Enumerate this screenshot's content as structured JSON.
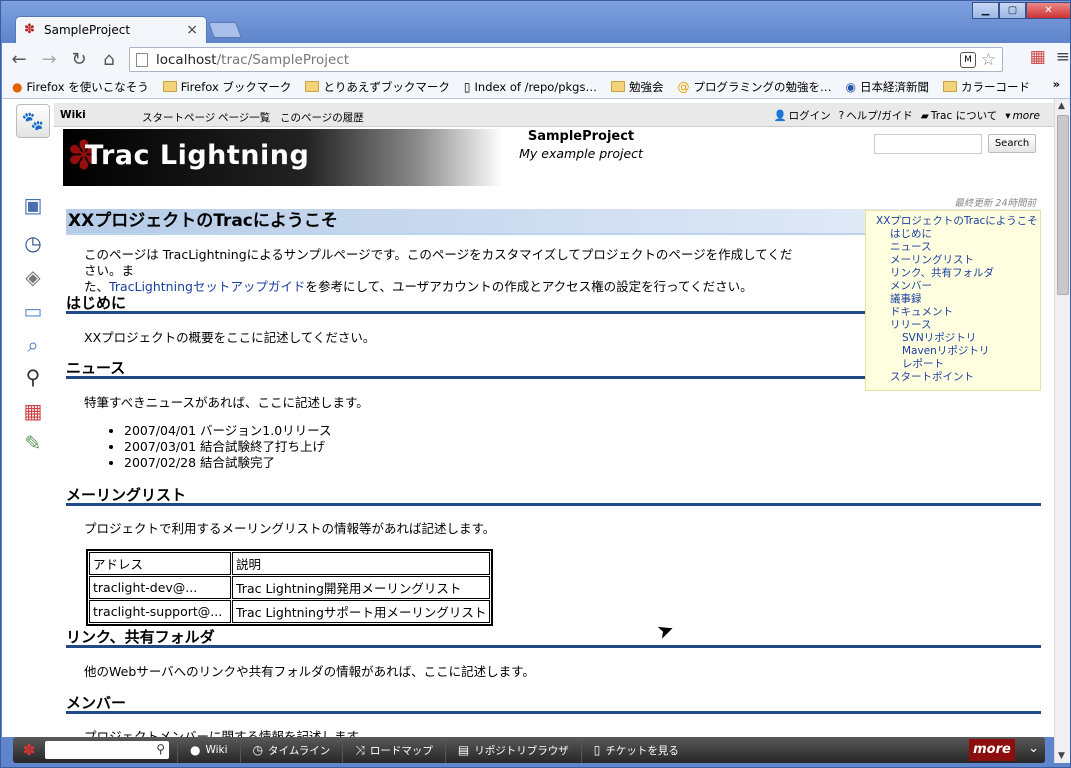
{
  "browser": {
    "tab_title": "SampleProject",
    "tab_close": "×",
    "url_host": "localhost",
    "url_path": "/trac/SampleProject"
  },
  "bookmarks": [
    {
      "label": "Firefox を使いこなそう",
      "icon": "firefox-icon"
    },
    {
      "label": "Firefox ブックマーク",
      "icon": "folder-icon"
    },
    {
      "label": "とりあえずブックマーク",
      "icon": "folder-icon"
    },
    {
      "label": "Index of /repo/pkgs…",
      "icon": "page-icon"
    },
    {
      "label": "勉強会",
      "icon": "folder-icon"
    },
    {
      "label": "プログラミングの勉強を…",
      "icon": "at-icon"
    },
    {
      "label": "日本経済新聞",
      "icon": "nikkei-icon"
    },
    {
      "label": "カラーコード",
      "icon": "folder-icon"
    }
  ],
  "mainnav": {
    "wiki": "Wiki",
    "start": "スタートページ",
    "index": "ページ一覧",
    "history": "このページの履歴"
  },
  "metanav": {
    "login": "ログイン",
    "help": "ヘルプ/ガイド",
    "about": "Trac について",
    "more": "more"
  },
  "header": {
    "logo_text": "Trac Lightning",
    "project_name": "SampleProject",
    "project_desc": "My example project",
    "search_button": "Search",
    "last_modified": "最終更新 24時間前"
  },
  "content": {
    "title": "XXプロジェクトのTracにようこそ",
    "intro_1": "このページは TracLightningによるサンプルページです。このページをカスタマイズしてプロジェクトのページを作成してください。ま",
    "intro_2a": "た、",
    "intro_link": "TracLightningセットアップガイド",
    "intro_2b": "を参考にして、ユーザアカウントの作成とアクセス権の設定を行ってください。",
    "h_intro": "はじめに",
    "p_intro": "XXプロジェクトの概要をここに記述してください。",
    "h_news": "ニュース",
    "p_news": "特筆すべきニュースがあれば、ここに記述します。",
    "news": [
      "2007/04/01 バージョン1.0リリース",
      "2007/03/01 結合試験終了打ち上げ",
      "2007/02/28 結合試験完了"
    ],
    "h_ml": "メーリングリスト",
    "p_ml": "プロジェクトで利用するメーリングリストの情報等があれば記述します。",
    "ml_table": {
      "headers": [
        "アドレス",
        "説明"
      ],
      "rows": [
        [
          "traclight-dev@...",
          "Trac Lightning開発用メーリングリスト"
        ],
        [
          "traclight-support@...",
          "Trac Lightningサポート用メーリングリスト"
        ]
      ]
    },
    "h_links": "リンク、共有フォルダ",
    "p_links": "他のWebサーバへのリンクや共有フォルダの情報があれば、ここに記述します。",
    "h_members": "メンバー",
    "p_members": "プロジェクトメンバーに関する情報を記述します。"
  },
  "toc": [
    {
      "label": "XXプロジェクトのTracにようこそ",
      "level": 1
    },
    {
      "label": "はじめに",
      "level": 2
    },
    {
      "label": "ニュース",
      "level": 2
    },
    {
      "label": "メーリングリスト",
      "level": 2
    },
    {
      "label": "リンク、共有フォルダ",
      "level": 2
    },
    {
      "label": "メンバー",
      "level": 2
    },
    {
      "label": "議事録",
      "level": 2
    },
    {
      "label": "ドキュメント",
      "level": 2
    },
    {
      "label": "リリース",
      "level": 2
    },
    {
      "label": "SVNリポジトリ",
      "level": 3
    },
    {
      "label": "Mavenリポジトリ",
      "level": 3
    },
    {
      "label": "レポート",
      "level": 3
    },
    {
      "label": "スタートポイント",
      "level": 2
    }
  ],
  "tracbar": {
    "wiki": "Wiki",
    "timeline": "タイムライン",
    "roadmap": "ロードマップ",
    "browser": "リポジトリブラウザ",
    "ticket": "チケットを見る",
    "more": "more"
  }
}
